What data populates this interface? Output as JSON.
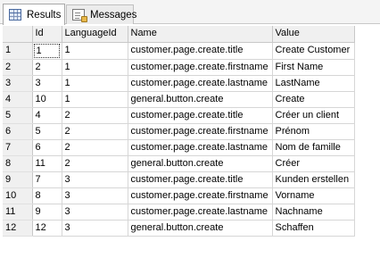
{
  "tabs": {
    "results_label": "Results",
    "messages_label": "Messages"
  },
  "grid": {
    "columns": [
      "Id",
      "LanguageId",
      "Name",
      "Value"
    ],
    "rows": [
      {
        "num": "1",
        "id": "1",
        "lang": "1",
        "name": "customer.page.create.title",
        "value": "Create Customer"
      },
      {
        "num": "2",
        "id": "2",
        "lang": "1",
        "name": "customer.page.create.firstname",
        "value": "First Name"
      },
      {
        "num": "3",
        "id": "3",
        "lang": "1",
        "name": "customer.page.create.lastname",
        "value": "LastName"
      },
      {
        "num": "4",
        "id": "10",
        "lang": "1",
        "name": "general.button.create",
        "value": "Create"
      },
      {
        "num": "5",
        "id": "4",
        "lang": "2",
        "name": "customer.page.create.title",
        "value": "Créer un client"
      },
      {
        "num": "6",
        "id": "5",
        "lang": "2",
        "name": "customer.page.create.firstname",
        "value": "Prénom"
      },
      {
        "num": "7",
        "id": "6",
        "lang": "2",
        "name": "customer.page.create.lastname",
        "value": "Nom de famille"
      },
      {
        "num": "8",
        "id": "11",
        "lang": "2",
        "name": "general.button.create",
        "value": "Créer"
      },
      {
        "num": "9",
        "id": "7",
        "lang": "3",
        "name": "customer.page.create.title",
        "value": "Kunden erstellen"
      },
      {
        "num": "10",
        "id": "8",
        "lang": "3",
        "name": "customer.page.create.firstname",
        "value": "Vorname"
      },
      {
        "num": "11",
        "id": "9",
        "lang": "3",
        "name": "customer.page.create.lastname",
        "value": "Nachname"
      },
      {
        "num": "12",
        "id": "12",
        "lang": "3",
        "name": "general.button.create",
        "value": "Schaffen"
      }
    ]
  }
}
